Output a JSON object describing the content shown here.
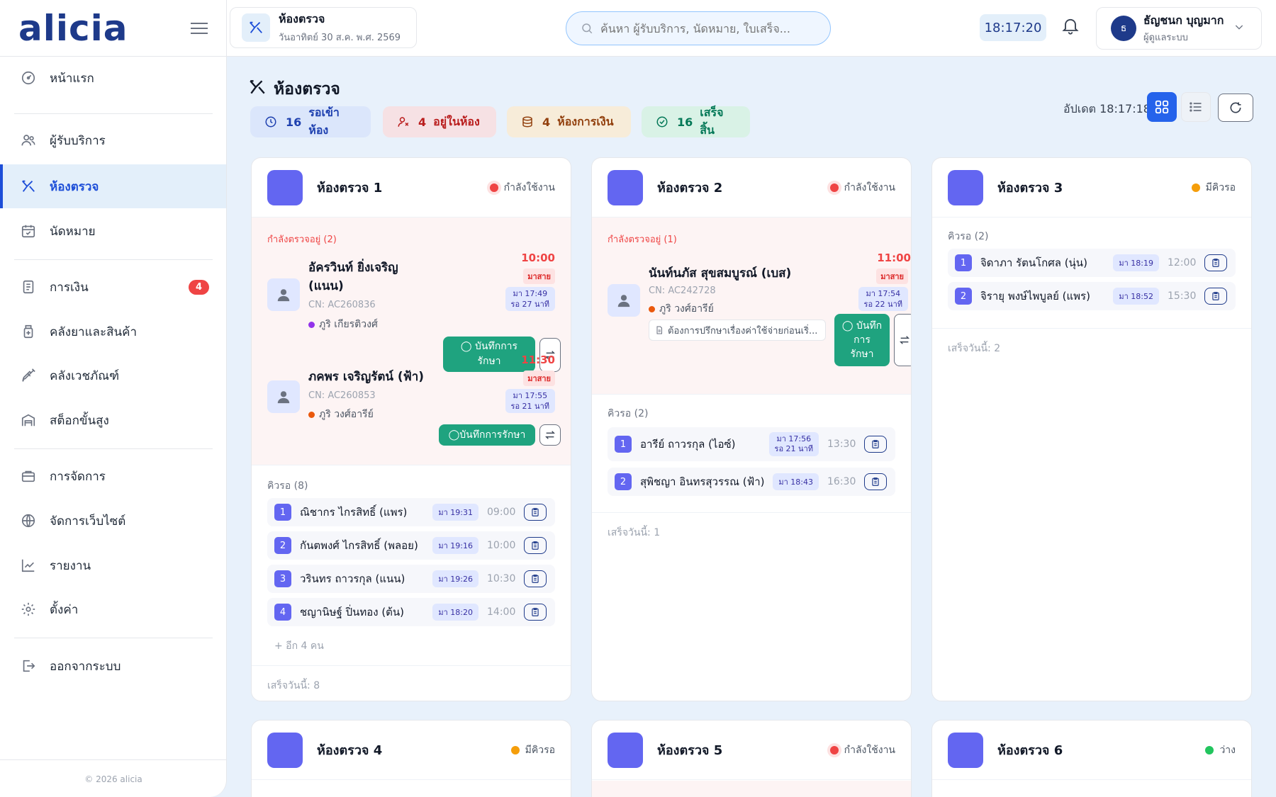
{
  "brand": {
    "logo": "alicia",
    "copyright": "© 2026 alicia"
  },
  "nav": {
    "home": "หน้าแรก",
    "clients": "ผู้รับบริการ",
    "exam_room": "ห้องตรวจ",
    "appointments": "นัดหมาย",
    "finance": "การเงิน",
    "finance_badge": "4",
    "pharmacy": "คลังยาและสินค้า",
    "supplies": "คลังเวชภัณฑ์",
    "advanced_stock": "สต็อกขั้นสูง",
    "management": "การจัดการ",
    "website": "จัดการเว็บไซต์",
    "reports": "รายงาน",
    "settings": "ตั้งค่า",
    "logout": "ออกจากระบบ"
  },
  "topbar": {
    "page_title": "ห้องตรวจ",
    "page_date": "วันอาทิตย์ 30 ส.ค. พ.ศ. 2569",
    "search_placeholder": "ค้นหา ผู้รับบริการ, นัดหมาย, ใบเสร็จ...",
    "clock": "18:17:20",
    "user_initial": "ธ",
    "user_name": "ธัญชนก บุญมาก",
    "user_role": "ผู้ดูแลระบบ"
  },
  "main": {
    "title": "ห้องตรวจ",
    "updated": "อัปเดต 18:17:18",
    "stats": [
      {
        "count": "16",
        "label": "รอเข้าห้อง",
        "color": "#1e40af",
        "bg": "#dbe6fb"
      },
      {
        "count": "4",
        "label": "อยู่ในห้อง",
        "color": "#b91c1c",
        "bg": "#f6e1e4"
      },
      {
        "count": "4",
        "label": "ห้องการเงิน",
        "color": "#92400e",
        "bg": "#f7ecd9"
      },
      {
        "count": "16",
        "label": "เสร็จสิ้น",
        "color": "#047857",
        "bg": "#d9f2e6"
      }
    ]
  },
  "rooms": [
    {
      "name": "ห้องตรวจ 1",
      "status": "กำลังใช้งาน",
      "active_label": "กำลังตรวจอยู่ (2)",
      "active": [
        {
          "name_l1": "อัครวินท์ ยิ่งเจริญ",
          "name_l2": "(แนน)",
          "cn": "CN: AC260836",
          "doctor": "ภูริ เกียรติวงศ์",
          "time": "10:00",
          "late": "มาสาย",
          "arrive_l1": "มา 17:49",
          "arrive_l2": "รอ 27 นาที",
          "record_l1": "บันทึกการ",
          "record_l2": "รักษา"
        },
        {
          "name_l1": "ภคพร เจริญรัตน์ (ฟ้า)",
          "cn": "CN: AC260853",
          "doctor": "ภูริ วงศ์อารีย์",
          "time": "11:30",
          "late": "มาสาย",
          "arrive_l1": "มา 17:55",
          "arrive_l2": "รอ 21 นาที",
          "record": "บันทึกการรักษา"
        }
      ],
      "queue_label": "คิวรอ (8)",
      "queue": [
        {
          "num": "1",
          "name": "ณิชากร ไกรสิทธิ์ (แพร)",
          "arrive": "มา 19:31",
          "time": "09:00"
        },
        {
          "num": "2",
          "name": "กันตพงศ์ ไกรสิทธิ์ (พลอย)",
          "arrive": "มา 19:16",
          "time": "10:00"
        },
        {
          "num": "3",
          "name": "วรินทร ถาวรกุล (แนน)",
          "arrive": "มา 19:26",
          "time": "10:30"
        },
        {
          "num": "4",
          "name": "ชญานิษฐ์ ปิ่นทอง (ต้น)",
          "arrive": "มา 18:20",
          "time": "14:00"
        }
      ],
      "more": "+ อีก 4 คน",
      "done": "เสร็จวันนี้: 8"
    },
    {
      "name": "ห้องตรวจ 2",
      "status": "กำลังใช้งาน",
      "active_label": "กำลังตรวจอยู่ (1)",
      "active": [
        {
          "name_l1": "นันท์นภัส สุขสมบูรณ์ (เบส)",
          "cn": "CN: AC242728",
          "doctor": "ภูริ วงศ์อารีย์",
          "note": "ต้องการปรึกษาเรื่องค่าใช้จ่ายก่อนเริ่...",
          "time": "11:00",
          "late": "มาสาย",
          "arrive_l1": "มา 17:54",
          "arrive_l2": "รอ 22 นาที",
          "record_l1": "บันทึก",
          "record_l2": "การ",
          "record_l3": "รักษา"
        }
      ],
      "queue_label": "คิวรอ (2)",
      "queue": [
        {
          "num": "1",
          "name": "อารีย์ ถาวรกุล (ไอซ์)",
          "arrive_l1": "มา 17:56",
          "arrive_l2": "รอ 21 นาที",
          "time": "13:30"
        },
        {
          "num": "2",
          "name": "สุพิชญา อินทรสุวรรณ (ฟ้า)",
          "arrive": "มา 18:43",
          "time": "16:30"
        }
      ],
      "done": "เสร็จวันนี้: 1"
    },
    {
      "name": "ห้องตรวจ 3",
      "status": "มีคิวรอ",
      "queue_label": "คิวรอ (2)",
      "queue": [
        {
          "num": "1",
          "name": "จิดาภา รัตนโกศล (นุ่น)",
          "arrive": "มา 18:19",
          "time": "12:00"
        },
        {
          "num": "2",
          "name": "จิรายุ พงษ์ไพบูลย์ (แพร)",
          "arrive": "มา 18:52",
          "time": "15:30"
        }
      ],
      "done": "เสร็จวันนี้: 2"
    },
    {
      "name": "ห้องตรวจ 4",
      "status": "มีคิวรอ"
    },
    {
      "name": "ห้องตรวจ 5",
      "status": "กำลังใช้งาน"
    },
    {
      "name": "ห้องตรวจ 6",
      "status": "ว่าง"
    }
  ]
}
